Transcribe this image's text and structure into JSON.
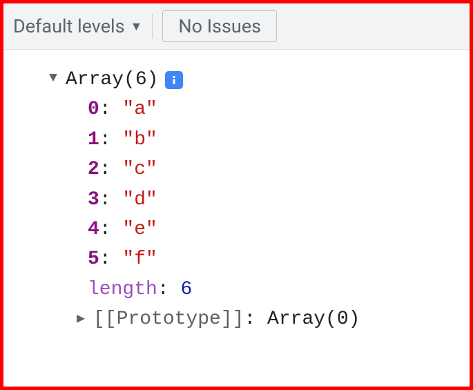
{
  "toolbar": {
    "levels_label": "Default levels",
    "issues_label": "No Issues"
  },
  "console": {
    "summary": "Array(6)",
    "info_icon": "info-icon",
    "items": [
      {
        "key": "0",
        "value": "\"a\""
      },
      {
        "key": "1",
        "value": "\"b\""
      },
      {
        "key": "2",
        "value": "\"c\""
      },
      {
        "key": "3",
        "value": "\"d\""
      },
      {
        "key": "4",
        "value": "\"e\""
      },
      {
        "key": "5",
        "value": "\"f\""
      }
    ],
    "length_label": "length",
    "length_value": "6",
    "prototype_label": "[[Prototype]]",
    "prototype_value": "Array(0)"
  }
}
